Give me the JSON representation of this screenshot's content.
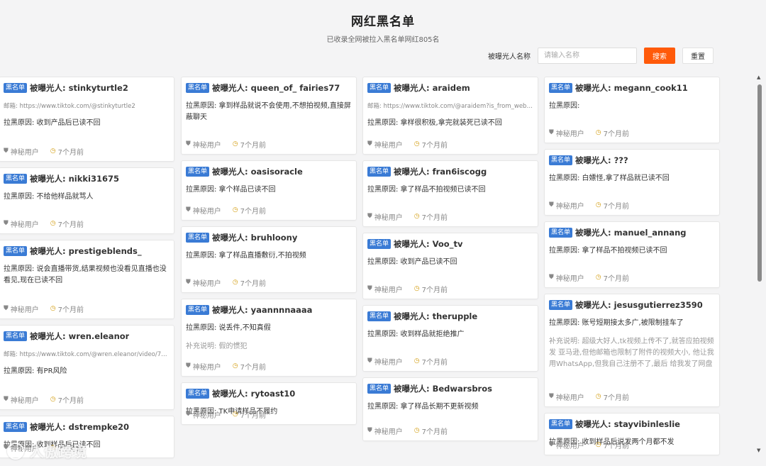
{
  "header": {
    "title": "网红黑名单",
    "subtitle": "已收录全网被拉入黑名单网红805名"
  },
  "search": {
    "label": "被曝光人名称",
    "placeholder": "请输入名称",
    "search_button": "搜索",
    "reset_button": "重置"
  },
  "common": {
    "badge": "黑名单",
    "user": "神秘用户",
    "time": "7个月前"
  },
  "columns": [
    [
      {
        "name": "被曝光人: stinkyturtle2",
        "email": "邮箱: https://www.tiktok.com/@stinkyturtle2",
        "reason": "拉黑原因: 收到产品后已读不回",
        "note": ""
      },
      {
        "name": "被曝光人: nikki31675",
        "email": "",
        "reason": "拉黑原因: 不给他样品就骂人",
        "note": ""
      },
      {
        "name": "被曝光人: prestigeblends_",
        "email": "",
        "reason": "拉黑原因: 说会直播带货,结果视频也没看见直播也没看见,现在已读不回",
        "note": ""
      },
      {
        "name": "被曝光人: wren.eleanor",
        "email": "邮箱: https://www.tiktok.com/@wren.eleanor/video/70…",
        "reason": "拉黑原因: 有PR风险",
        "note": ""
      },
      {
        "name": "被曝光人: dstrempke20",
        "email": "",
        "reason": "拉黑原因: 收到样品后已读不回",
        "note": ""
      }
    ],
    [
      {
        "name": "被曝光人: queen_of_ fairies77",
        "email": "",
        "reason": "拉黑原因: 拿到样品就说不会使用,不想拍视频,直接屏蔽聊天",
        "note": ""
      },
      {
        "name": "被曝光人: oasisoracle",
        "email": "",
        "reason": "拉黑原因: 拿个样品已读不回",
        "note": ""
      },
      {
        "name": "被曝光人: bruhloony",
        "email": "",
        "reason": "拉黑原因: 拿了样品直播敷衍,不拍视频",
        "note": ""
      },
      {
        "name": "被曝光人: yaannnnaaaa",
        "email": "",
        "reason": "拉黑原因: 说丢件,不知真假",
        "note": "补充说明: 假的惯犯"
      },
      {
        "name": "被曝光人: rytoast10",
        "email": "",
        "reason": "拉黑原因: TK申请样品不履约",
        "note": ""
      }
    ],
    [
      {
        "name": "被曝光人: araidem",
        "email": "邮箱: https://www.tiktok.com/@araidem?is_from_weba…",
        "reason": "拉黑原因: 拿样很积极,拿完就装死已读不回",
        "note": ""
      },
      {
        "name": "被曝光人: fran6iscogg",
        "email": "",
        "reason": "拉黑原因: 拿了样品不拍视频已读不回",
        "note": ""
      },
      {
        "name": "被曝光人: Voo_tv",
        "email": "",
        "reason": "拉黑原因: 收到产品已读不回",
        "note": ""
      },
      {
        "name": "被曝光人: therupple",
        "email": "",
        "reason": "拉黑原因: 收到样品就拒绝推广",
        "note": ""
      },
      {
        "name": "被曝光人: Bedwarsbros",
        "email": "",
        "reason": "拉黑原因: 拿了样品长期不更新视频",
        "note": ""
      }
    ],
    [
      {
        "name": "被曝光人: megann_cook11",
        "email": "",
        "reason": "拉黑原因:",
        "note": ""
      },
      {
        "name": "被曝光人: ???",
        "email": "",
        "reason": "拉黑原因: 白嫖怪,拿了样品就已读不回",
        "note": ""
      },
      {
        "name": "被曝光人: manuel_annang",
        "email": "",
        "reason": "拉黑原因: 拿了样品不拍视频已读不回",
        "note": ""
      },
      {
        "name": "被曝光人: jesusgutierrez3590",
        "email": "",
        "reason": "拉黑原因: 账号短期接太多广,被限制挂车了",
        "note": "补充说明: 超级大好人,tk视频上传不了,就答应拍视频发 亚马逊,但他邮箱也限制了附件的视频大小, 他让我用WhatsApp,但我自己注册不了,最后 给我发了网盘"
      },
      {
        "name": "被曝光人: stayvibinleslie",
        "email": "",
        "reason": "拉黑原因: 收到样品后说发两个月都不发",
        "note": ""
      }
    ]
  ],
  "watermark": "人傲跨境"
}
